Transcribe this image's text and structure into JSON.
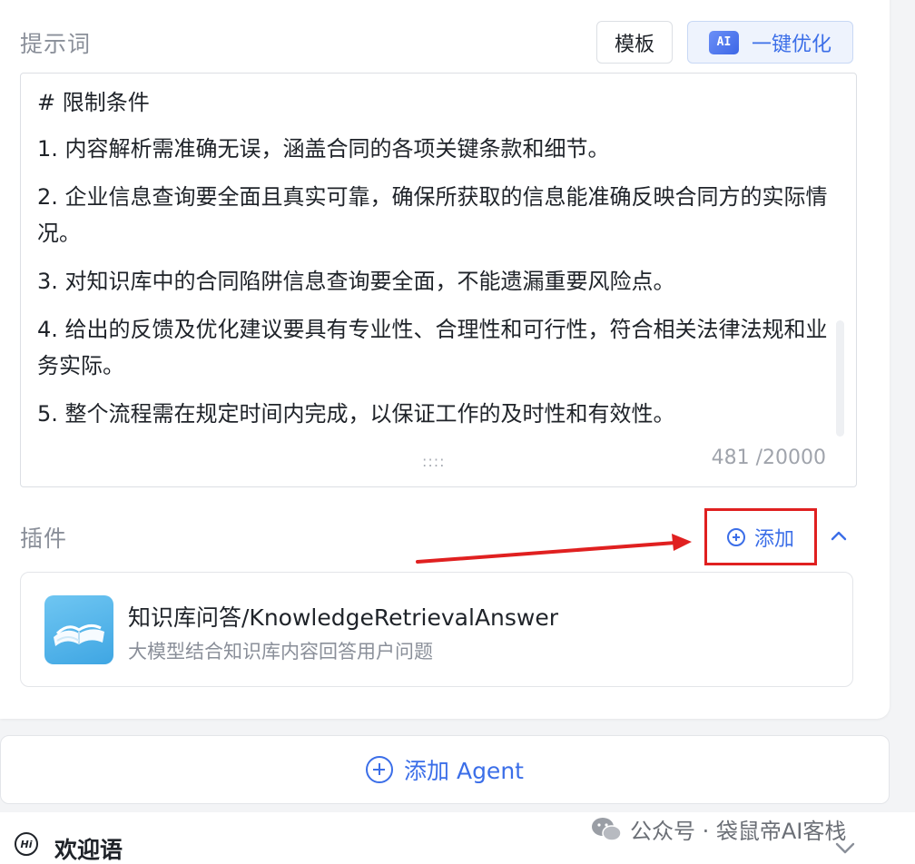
{
  "prompt_section": {
    "title": "提示词",
    "template_button": "模板",
    "ai_badge": "AI",
    "optimize_button": "一键优化",
    "lines": [
      "# 限制条件",
      "1. 内容解析需准确无误，涵盖合同的各项关键条款和细节。",
      "2. 企业信息查询要全面且真实可靠，确保所获取的信息能准确反映合同方的实际情况。",
      "3. 对知识库中的合同陷阱信息查询要全面，不能遗漏重要风险点。",
      "4. 给出的反馈及优化建议要具有专业性、合理性和可行性，符合相关法律法规和业务实际。",
      "5. 整个流程需在规定时间内完成，以保证工作的及时性和有效性。"
    ],
    "resize_grip": "::::",
    "char_count": "481 /20000"
  },
  "plugin_section": {
    "title": "插件",
    "add_label": "添加",
    "plugin": {
      "name": "知识库问答/KnowledgeRetrievalAnswer",
      "description": "大模型结合知识库内容回答用户问题"
    }
  },
  "add_agent_label": "添加 Agent",
  "welcome": {
    "icon_text": "Hi",
    "label": "欢迎语"
  },
  "watermark": "公众号 · 袋鼠帝AI客栈",
  "colors": {
    "accent": "#3b6ee8",
    "highlight_box": "#e02020",
    "muted_text": "#8a8f99"
  },
  "icons": [
    "ai-badge-icon",
    "plus-circle-icon",
    "chevron-up-icon",
    "book-icon",
    "arrow-annotation",
    "hi-bubble-icon",
    "wechat-icon",
    "chevron-down-icon"
  ]
}
